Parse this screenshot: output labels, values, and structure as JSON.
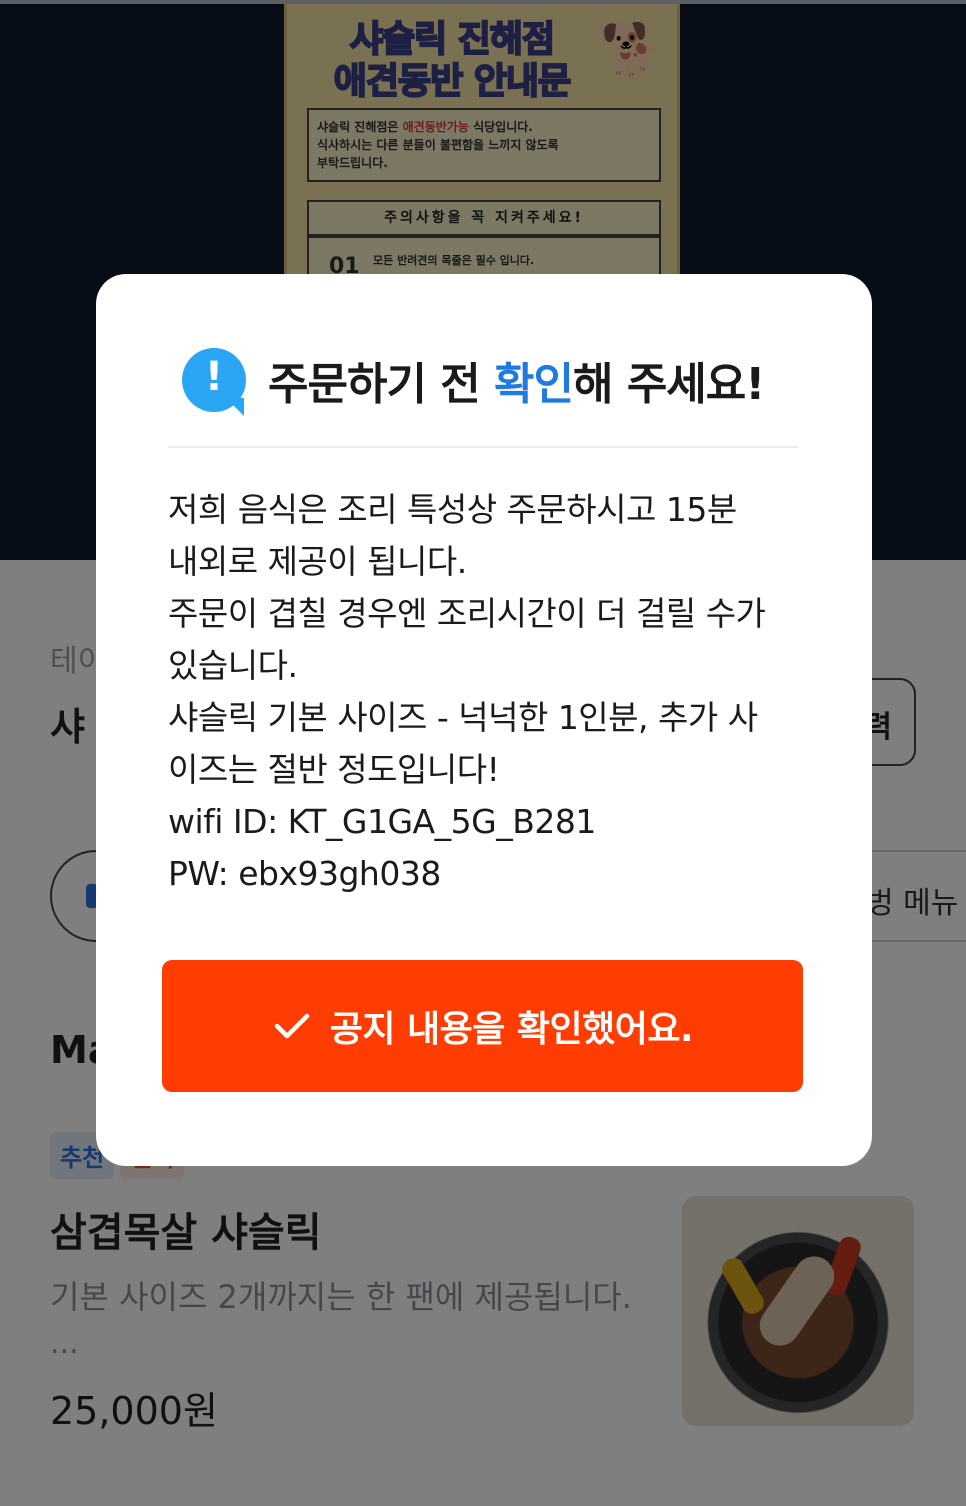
{
  "poster": {
    "title_line1": "샤슬릭 진해점",
    "title_line2a": "애견동반 ",
    "title_line2b": "안내문",
    "intro_a": "샤슬릭 진해점은 ",
    "intro_b": "애견동반가능",
    "intro_c": " 식당입니다.",
    "intro_line2": "식사하시는 다른 분들이 불편함을 느끼지 않도록",
    "intro_line3": "부탁드립니다.",
    "notice_heading": "주의사항을 꼭 지켜주세요!",
    "rule_number": "01",
    "rule_text": "모든 반려견의 목줄은 필수 입니다."
  },
  "store": {
    "category_partial": "테이",
    "name_partial": "샤",
    "side_button_partial": "력",
    "right_pill_partial": "벙 메뉴"
  },
  "menu": {
    "section_title_partial": "Ma",
    "tags": [
      "추천",
      "인기"
    ],
    "item_name": "삼겹목살 샤슬릭",
    "item_desc": "기본 사이즈 2개까지는 한 팬에 제공됩니다.",
    "item_more": "...",
    "item_price": "25,000원"
  },
  "modal": {
    "icon": "exclamation-icon",
    "icon_glyph": "!",
    "title_before": "주문하기 전 ",
    "title_accent": "확인",
    "title_after": "해 주세요!",
    "body_lines": [
      "저희 음식은 조리 특성상 주문하시고 15분",
      "내외로 제공이 됩니다.",
      "주문이 겹칠 경우엔 조리시간이 더 걸릴 수가",
      "있습니다.",
      "샤슬릭 기본 사이즈 - 넉넉한 1인분, 추가 사",
      "이즈는 절반 정도입니다!",
      "wifi ID: KT_G1GA_5G_B281",
      "PW: ebx93gh038"
    ],
    "confirm_label": "공지 내용을 확인했어요."
  },
  "colors": {
    "accent_blue": "#1f7ae0",
    "icon_blue": "#2aa6f5",
    "button_orange": "#ff3d03",
    "overlay": "rgba(0,0,0,0.5)"
  }
}
